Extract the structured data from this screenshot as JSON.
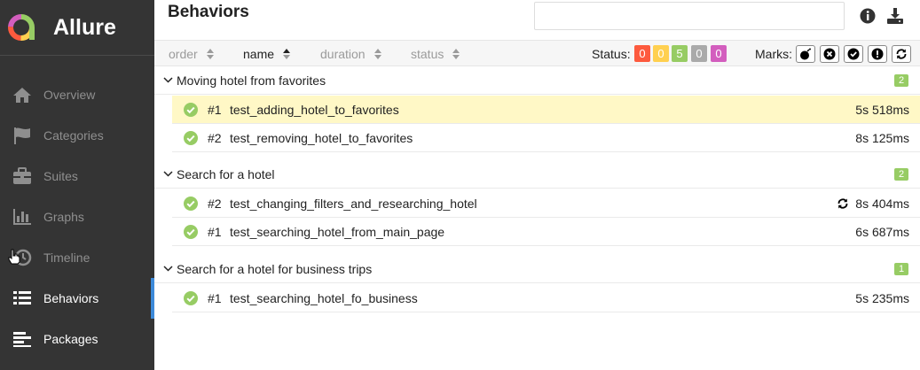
{
  "app": {
    "title": "Allure",
    "logo_icon": "allure-logo-icon"
  },
  "sidebar": {
    "items": [
      {
        "label": "Overview",
        "icon": "home-icon",
        "active": false
      },
      {
        "label": "Categories",
        "icon": "flag-icon",
        "active": false
      },
      {
        "label": "Suites",
        "icon": "briefcase-icon",
        "active": false
      },
      {
        "label": "Graphs",
        "icon": "bar-chart-icon",
        "active": false
      },
      {
        "label": "Timeline",
        "icon": "history-icon",
        "active": false
      },
      {
        "label": "Behaviors",
        "icon": "list-icon",
        "active": true
      },
      {
        "label": "Packages",
        "icon": "align-left-icon",
        "active": false
      }
    ]
  },
  "header": {
    "title": "Behaviors",
    "search_value": "",
    "info_icon": "info-icon",
    "download_icon": "download-icon"
  },
  "toolbar": {
    "sort_columns": [
      {
        "label": "order",
        "active": false
      },
      {
        "label": "name",
        "active": true
      },
      {
        "label": "duration",
        "active": false
      },
      {
        "label": "status",
        "active": false
      }
    ],
    "status_label": "Status:",
    "status_badges": [
      {
        "value": "0",
        "color": "#fd5a3e"
      },
      {
        "value": "0",
        "color": "#ffd050"
      },
      {
        "value": "5",
        "color": "#97cc64"
      },
      {
        "value": "0",
        "color": "#aaaaaa"
      },
      {
        "value": "0",
        "color": "#d35ebe"
      }
    ],
    "marks_label": "Marks:",
    "marks": [
      "bomb-icon",
      "times-circle-icon",
      "check-circle-icon",
      "exclamation-circle-icon",
      "refresh-icon"
    ]
  },
  "groups": [
    {
      "name": "Moving hotel from favorites",
      "count": "2",
      "tests": [
        {
          "id": "#1",
          "name": "test_adding_hotel_to_favorites",
          "duration": "5s 518ms",
          "selected": true,
          "retry": false
        },
        {
          "id": "#2",
          "name": "test_removing_hotel_to_favorites",
          "duration": "8s 125ms",
          "selected": false,
          "retry": false
        }
      ]
    },
    {
      "name": "Search for a hotel",
      "count": "2",
      "tests": [
        {
          "id": "#2",
          "name": "test_changing_filters_and_researching_hotel",
          "duration": "8s 404ms",
          "selected": false,
          "retry": true
        },
        {
          "id": "#1",
          "name": "test_searching_hotel_from_main_page",
          "duration": "6s 687ms",
          "selected": false,
          "retry": false
        }
      ]
    },
    {
      "name": "Search for a hotel for business trips",
      "count": "1",
      "tests": [
        {
          "id": "#1",
          "name": "test_searching_hotel_fo_business",
          "duration": "5s 235ms",
          "selected": false,
          "retry": false
        }
      ]
    }
  ],
  "colors": {
    "sidebar_bg": "#343434",
    "accent": "#3d8ad9",
    "passed": "#97cc64",
    "selected_row": "#fff8c6"
  }
}
